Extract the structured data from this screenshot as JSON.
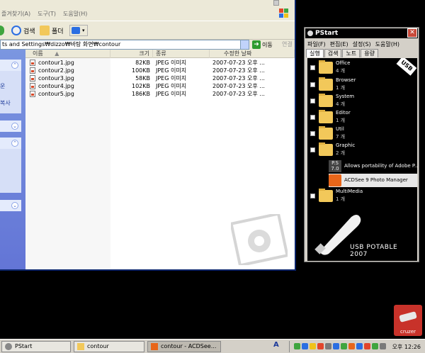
{
  "explorer": {
    "menu": [
      "즐겨찾기(A)",
      "도구(T)",
      "도움말(H)"
    ],
    "toolbar": {
      "search_label": "검색",
      "folders_label": "폴더"
    },
    "address": "ts and Settings₩dizzo₩바탕 화면₩contour",
    "go_label": "이동",
    "links_label": "연결",
    "left_pane": {
      "text_1": "운",
      "text_2": "복사"
    },
    "columns": {
      "name": "이름",
      "size": "크기",
      "type": "종류",
      "modified": "수정한 날짜"
    },
    "files": [
      {
        "name": "contour1.jpg",
        "size": "82KB",
        "type": "JPEG 이미지",
        "modified": "2007-07-23 오후 ..."
      },
      {
        "name": "contour2.jpg",
        "size": "100KB",
        "type": "JPEG 이미지",
        "modified": "2007-07-23 오후 ..."
      },
      {
        "name": "contour3.jpg",
        "size": "58KB",
        "type": "JPEG 이미지",
        "modified": "2007-07-23 오후 ..."
      },
      {
        "name": "contour4.jpg",
        "size": "102KB",
        "type": "JPEG 이미지",
        "modified": "2007-07-23 오후 ..."
      },
      {
        "name": "contour5.jpg",
        "size": "186KB",
        "type": "JPEG 이미지",
        "modified": "2007-07-23 오후 ..."
      }
    ]
  },
  "pstart": {
    "title": "PStart",
    "close": "✕",
    "menu": [
      "파일(F)",
      "편집(E)",
      "설정(S)",
      "도움말(H)"
    ],
    "tabs": [
      "실행",
      "검색",
      "노트",
      "용량"
    ],
    "groups": [
      {
        "name": "Office",
        "count": "4 개"
      },
      {
        "name": "Browser",
        "count": "1 개"
      },
      {
        "name": "System",
        "count": "4 개"
      },
      {
        "name": "Editor",
        "count": "1 개"
      },
      {
        "name": "Util",
        "count": "7 개"
      },
      {
        "name": "Graphic",
        "count": "2 개"
      },
      {
        "name": "MultiMedia",
        "count": "1 개"
      }
    ],
    "graphic_items": [
      "Allows portability of Adobe P...",
      "ACDSee 9 Photo Manager"
    ],
    "usb_tag": "USB",
    "footer": "USB POTABLE 2007"
  },
  "cruzer_label": "cruzer",
  "taskbar": {
    "buttons": [
      "PStart",
      "contour",
      "contour - ACDSee..."
    ],
    "lang": "A",
    "clock": "오후 12:26"
  },
  "colors": {
    "selection": "#e8e8e8",
    "xp_blue": "#0a246a",
    "folder": "#f2c85a"
  }
}
